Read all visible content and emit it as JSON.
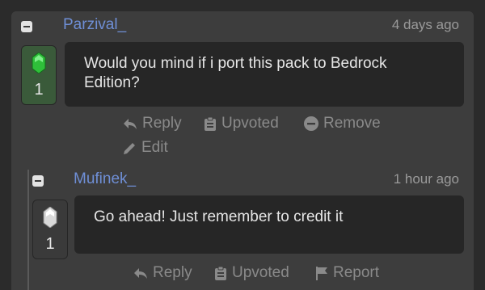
{
  "comment1": {
    "author": "Parzival_",
    "time": "4 days ago",
    "votes": "1",
    "body": "Would you mind if i port this pack to Bedrock Edition?",
    "actions": {
      "reply": "Reply",
      "upvoted": "Upvoted",
      "remove": "Remove",
      "edit": "Edit"
    }
  },
  "comment2": {
    "author": "Mufinek_",
    "time": "1 hour ago",
    "votes": "1",
    "body": "Go ahead! Just remember to credit it",
    "actions": {
      "reply": "Reply",
      "upvoted": "Upvoted",
      "report": "Report"
    }
  },
  "colors": {
    "author": "#6f8fd6",
    "background": "#3d3d3d",
    "bubble": "#262626",
    "upvote_active": "#3a5a3a",
    "emerald": "#2fbf3a"
  }
}
